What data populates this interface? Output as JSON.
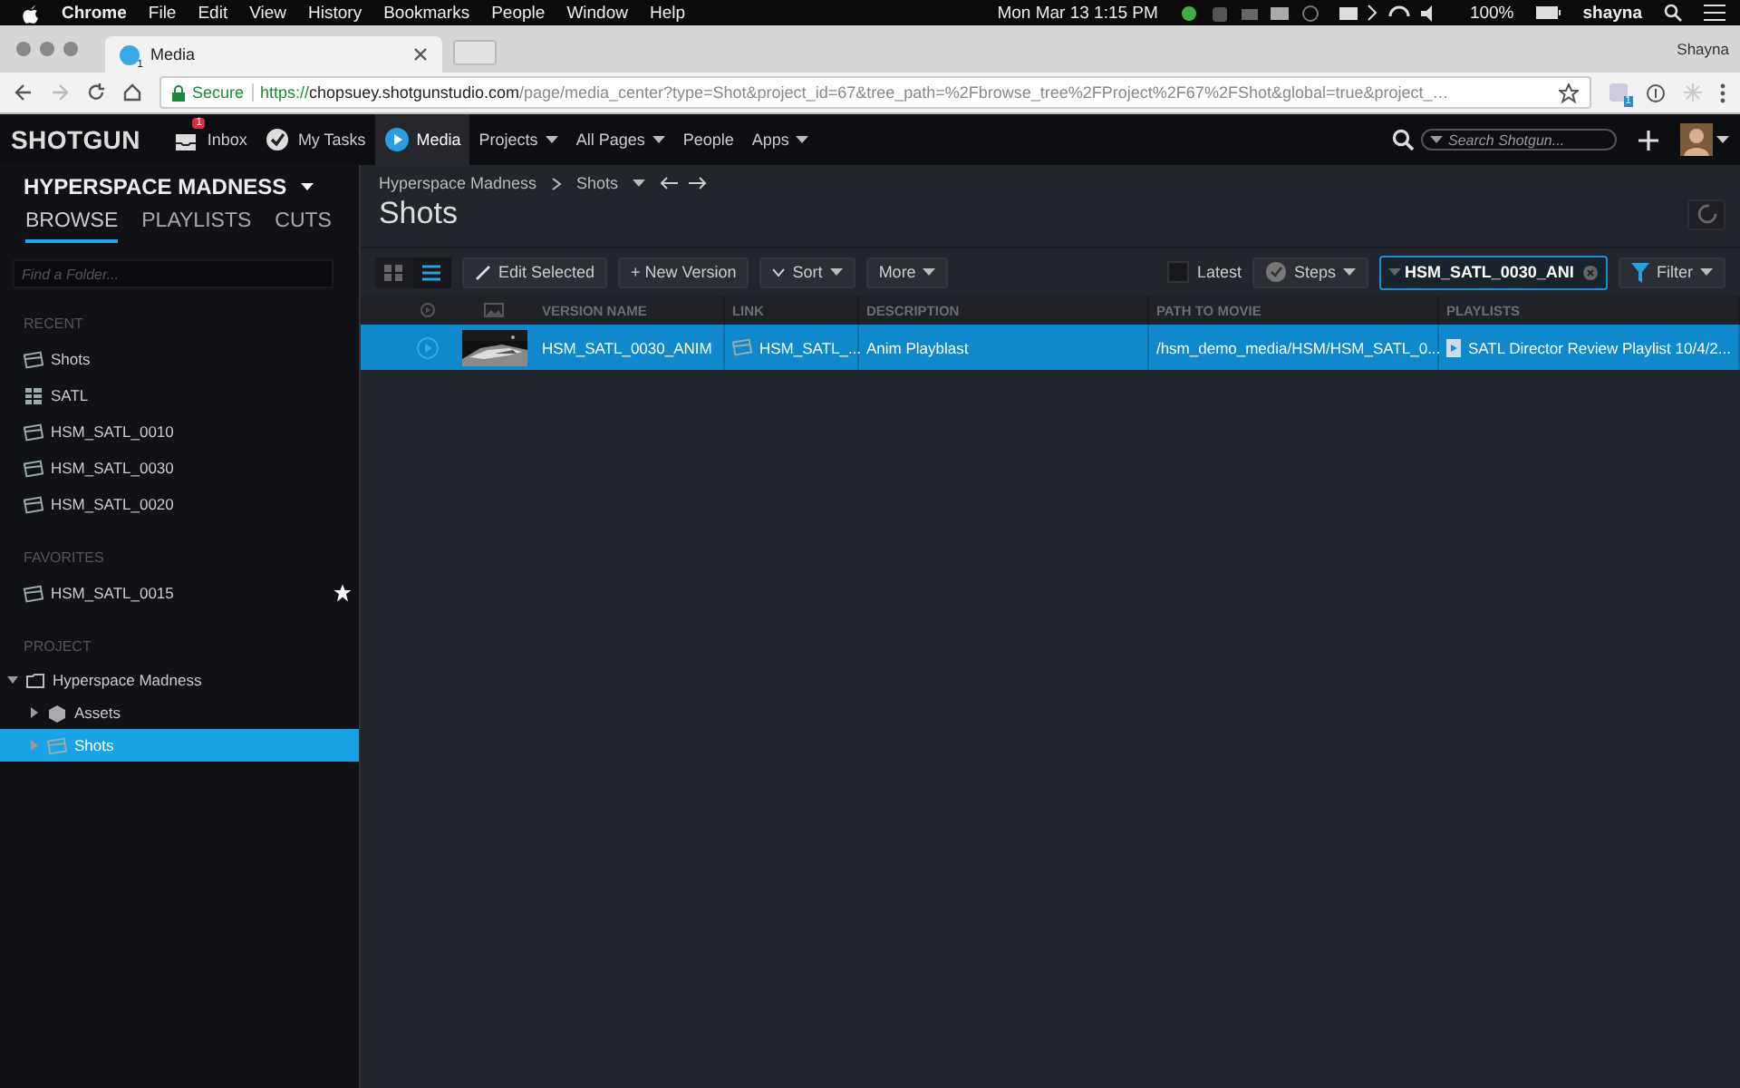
{
  "menubar": {
    "app": "Chrome",
    "items": [
      "File",
      "Edit",
      "View",
      "History",
      "Bookmarks",
      "People",
      "Window",
      "Help"
    ],
    "clock": "Mon Mar 13  1:15 PM",
    "battery": "100%",
    "user": "shayna"
  },
  "browser": {
    "tab_title": "Media",
    "tab_badge": "1",
    "profile": "Shayna",
    "secure": "Secure",
    "url_scheme": "https://",
    "url_host": "chopsuey.shotgunstudio.com",
    "url_path": "/page/media_center?type=Shot&project_id=67&tree_path=%2Fbrowse_tree%2FProject%2F67%2FShot&global=true&project_…",
    "ext_badge": "1"
  },
  "nav": {
    "logo": "SHOTGUN",
    "items": [
      {
        "label": "Inbox",
        "kind": "inbox",
        "badge": "1",
        "menu": false,
        "selected": false
      },
      {
        "label": "My Tasks",
        "kind": "tasks",
        "menu": false,
        "selected": false
      },
      {
        "label": "Media",
        "kind": "media",
        "menu": false,
        "selected": true
      },
      {
        "label": "Projects",
        "kind": "plain",
        "menu": true,
        "selected": false
      },
      {
        "label": "All Pages",
        "kind": "plain",
        "menu": true,
        "selected": false
      },
      {
        "label": "People",
        "kind": "plain",
        "menu": false,
        "selected": false
      },
      {
        "label": "Apps",
        "kind": "plain",
        "menu": true,
        "selected": false
      }
    ],
    "search_placeholder": "Search Shotgun..."
  },
  "sidebar": {
    "project": "HYPERSPACE MADNESS",
    "tabs": [
      {
        "label": "BROWSE",
        "selected": true
      },
      {
        "label": "PLAYLISTS",
        "selected": false
      },
      {
        "label": "CUTS",
        "selected": false
      }
    ],
    "find_placeholder": "Find a Folder...",
    "sections": [
      {
        "heading": "RECENT",
        "items": [
          {
            "label": "Shots",
            "kind": "shot",
            "starred": false
          },
          {
            "label": "SATL",
            "kind": "sequence",
            "starred": false
          },
          {
            "label": "HSM_SATL_0010",
            "kind": "shot",
            "starred": false
          },
          {
            "label": "HSM_SATL_0030",
            "kind": "shot",
            "starred": false
          },
          {
            "label": "HSM_SATL_0020",
            "kind": "shot",
            "starred": false
          }
        ]
      },
      {
        "heading": "FAVORITES",
        "items": [
          {
            "label": "HSM_SATL_0015",
            "kind": "shot",
            "starred": true
          }
        ]
      }
    ],
    "project_heading": "PROJECT",
    "tree": [
      {
        "label": "Hyperspace Madness",
        "kind": "project",
        "expanded": true,
        "selected": false,
        "children": [
          {
            "label": "Assets",
            "kind": "asset",
            "expanded": false,
            "selected": false
          },
          {
            "label": "Shots",
            "kind": "shot",
            "expanded": false,
            "selected": true
          }
        ]
      }
    ]
  },
  "main": {
    "breadcrumb": [
      "Hyperspace Madness",
      "Shots"
    ],
    "title": "Shots",
    "toolbar": {
      "edit": "Edit Selected",
      "new": "+ New Version",
      "sort": "Sort",
      "more": "More",
      "latest": {
        "label": "Latest",
        "checked": false
      },
      "steps": "Steps",
      "search_value": "HSM_SATL_0030_ANI",
      "filter": "Filter"
    },
    "table": {
      "columns": [
        "VERSION NAME",
        "LINK",
        "DESCRIPTION",
        "PATH TO MOVIE",
        "PLAYLISTS"
      ],
      "rows": [
        {
          "selected": true,
          "cells": [
            "HSM_SATL_0030_ANIM",
            "HSM_SATL_...",
            "Anim Playblast",
            "/hsm_demo_media/HSM/HSM_SATL_0...",
            "SATL Director Review Playlist 10/4/2..."
          ]
        }
      ]
    }
  }
}
